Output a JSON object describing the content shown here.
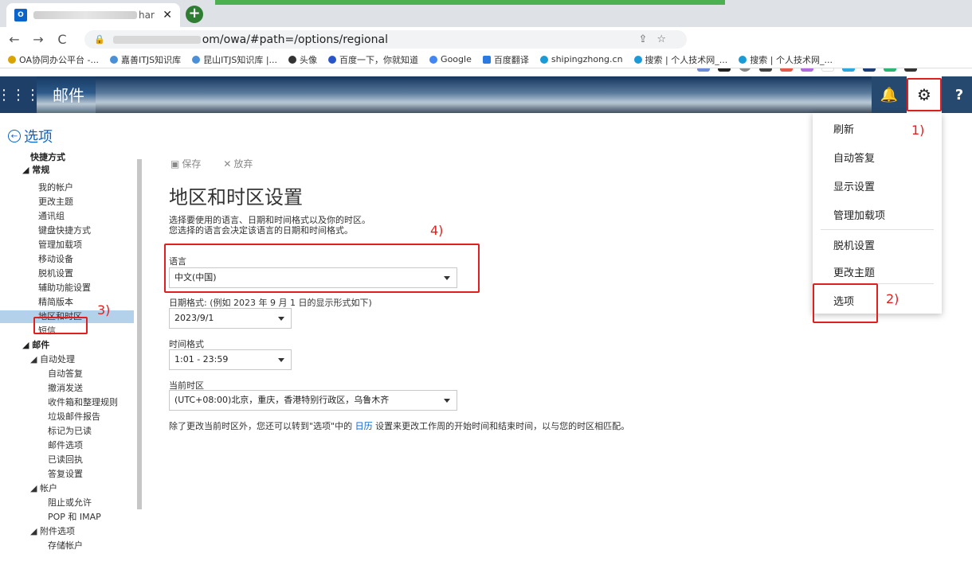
{
  "browser": {
    "tab_title": "har",
    "url_path": "om/owa/#path=/options/regional",
    "bookmarks": [
      "OA协同办公平台 -...",
      "嘉善ITJS知识库",
      "昆山ITJS知识库 |...",
      "头像",
      "百度一下，你就知道",
      "Google",
      "百度翻译",
      "shipingzhong.cn",
      "搜索 | 个人技术网_...",
      "搜索 | 个人技术网_..."
    ]
  },
  "header": {
    "app_title": "邮件"
  },
  "back_label": "选项",
  "nav": {
    "shortcuts": "快捷方式",
    "general": "常规",
    "general_items": [
      "我的帐户",
      "更改主题",
      "通讯组",
      "键盘快捷方式",
      "管理加载项",
      "移动设备",
      "脱机设置",
      "辅助功能设置",
      "精简版本",
      "地区和时区",
      "短信"
    ],
    "mail": "邮件",
    "auto": "自动处理",
    "auto_items": [
      "自动答复",
      "撤消发送",
      "收件箱和整理规则",
      "垃圾邮件报告",
      "标记为已读",
      "邮件选项",
      "已读回执",
      "答复设置"
    ],
    "accounts": "帐户",
    "account_items": [
      "阻止或允许",
      "POP 和 IMAP"
    ],
    "attach": "附件选项",
    "attach_items": [
      "存储帐户"
    ]
  },
  "toolbar": {
    "save": "保存",
    "discard": "放弃"
  },
  "main": {
    "title": "地区和时区设置",
    "desc1": "选择要使用的语言、日期和时间格式以及你的时区。",
    "desc2": "您选择的语言会决定该语言的日期和时间格式。",
    "lang_label": "语言",
    "lang_value": "中文(中国)",
    "date_label": "日期格式: (例如 2023 年 9 月 1 日的显示形式如下)",
    "date_value": "2023/9/1",
    "time_label": "时间格式",
    "time_value": "1:01 - 23:59",
    "tz_label": "当前时区",
    "tz_value": "(UTC+08:00)北京，重庆，香港特别行政区，乌鲁木齐",
    "note_pre": "除了更改当前时区外，您还可以转到\"选项\"中的",
    "note_link": "日历",
    "note_post": "设置来更改工作周的开始时间和结束时间，以与您的时区相匹配。"
  },
  "menu": {
    "items": [
      "刷新",
      "自动答复",
      "显示设置",
      "管理加载项",
      "脱机设置",
      "更改主题",
      "选项"
    ]
  },
  "annotations": [
    "1)",
    "2)",
    "3)",
    "4)"
  ]
}
